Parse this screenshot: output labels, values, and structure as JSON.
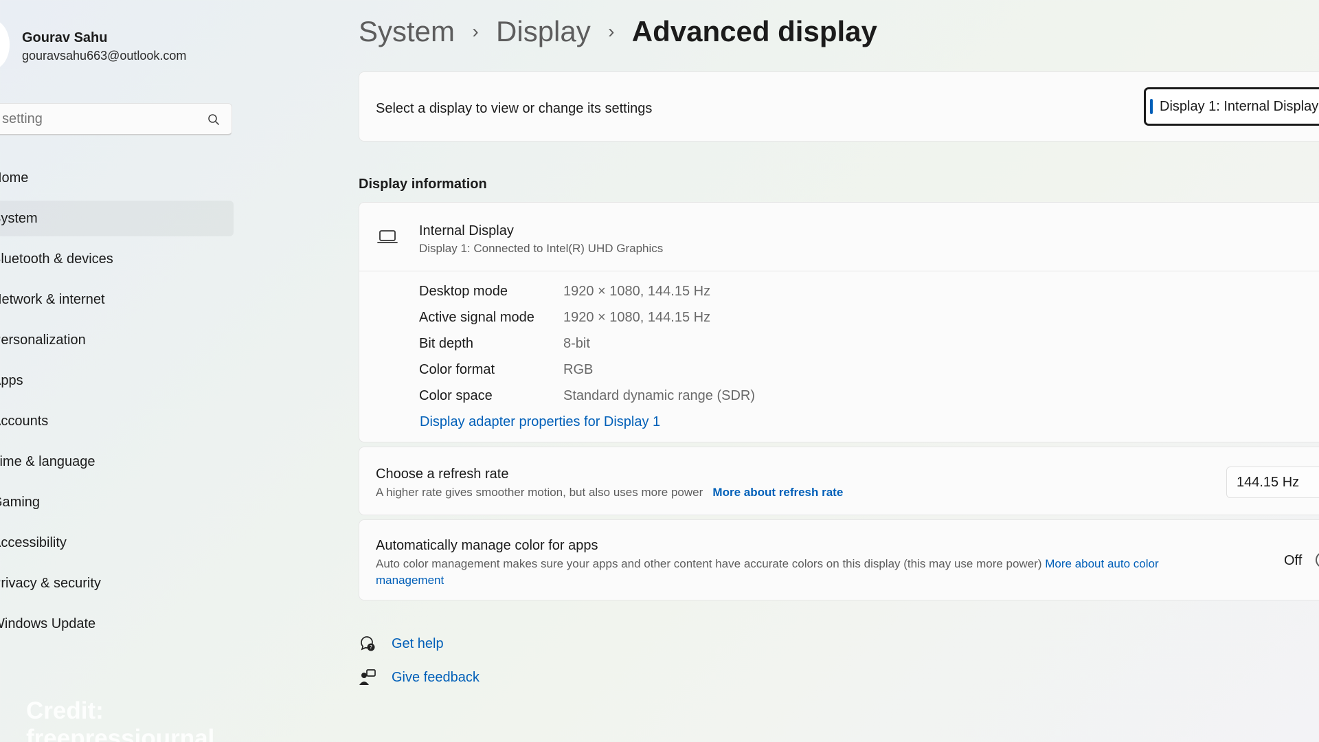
{
  "user": {
    "name": "Gourav Sahu",
    "email": "gouravsahu663@outlook.com"
  },
  "search": {
    "placeholder": "setting"
  },
  "nav": [
    {
      "label": "Home",
      "icon": "home-icon"
    },
    {
      "label": "System",
      "icon": "system-icon",
      "active": true
    },
    {
      "label": "Bluetooth & devices",
      "icon": "bluetooth-icon"
    },
    {
      "label": "Network & internet",
      "icon": "network-icon"
    },
    {
      "label": "Personalization",
      "icon": "brush-icon"
    },
    {
      "label": "Apps",
      "icon": "apps-icon"
    },
    {
      "label": "Accounts",
      "icon": "accounts-icon"
    },
    {
      "label": "Time & language",
      "icon": "clock-icon"
    },
    {
      "label": "Gaming",
      "icon": "gaming-icon"
    },
    {
      "label": "Accessibility",
      "icon": "accessibility-icon"
    },
    {
      "label": "Privacy & security",
      "icon": "shield-icon"
    },
    {
      "label": "Windows Update",
      "icon": "update-icon"
    }
  ],
  "breadcrumb": {
    "items": [
      "System",
      "Display"
    ],
    "current": "Advanced display",
    "separator": "›"
  },
  "display_select": {
    "label": "Select a display to view or change its settings",
    "value": "Display 1: Internal Display"
  },
  "display_info": {
    "section_title": "Display information",
    "title": "Internal Display",
    "subtitle": "Display 1: Connected to Intel(R) UHD Graphics",
    "rows": [
      {
        "key": "Desktop mode",
        "value": "1920 × 1080, 144.15 Hz"
      },
      {
        "key": "Active signal mode",
        "value": "1920 × 1080, 144.15 Hz"
      },
      {
        "key": "Bit depth",
        "value": "8-bit"
      },
      {
        "key": "Color format",
        "value": "RGB"
      },
      {
        "key": "Color space",
        "value": "Standard dynamic range (SDR)"
      }
    ],
    "adapter_link": "Display adapter properties for Display 1"
  },
  "refresh_rate": {
    "title": "Choose a refresh rate",
    "description": "A higher rate gives smoother motion, but also uses more power",
    "link": "More about refresh rate",
    "value": "144.15 Hz"
  },
  "auto_color": {
    "title": "Automatically manage color for apps",
    "description": "Auto color management makes sure your apps and other content have accurate colors on this display (this may use more power)",
    "link": "More about auto color management",
    "state": "Off"
  },
  "help": {
    "get_help": "Get help",
    "give_feedback": "Give feedback"
  },
  "watermark": "Credit: freepressjournal",
  "colors": {
    "accent": "#005fb8",
    "text": "#1b1b1b",
    "secondary_text": "#5d5d5d"
  }
}
